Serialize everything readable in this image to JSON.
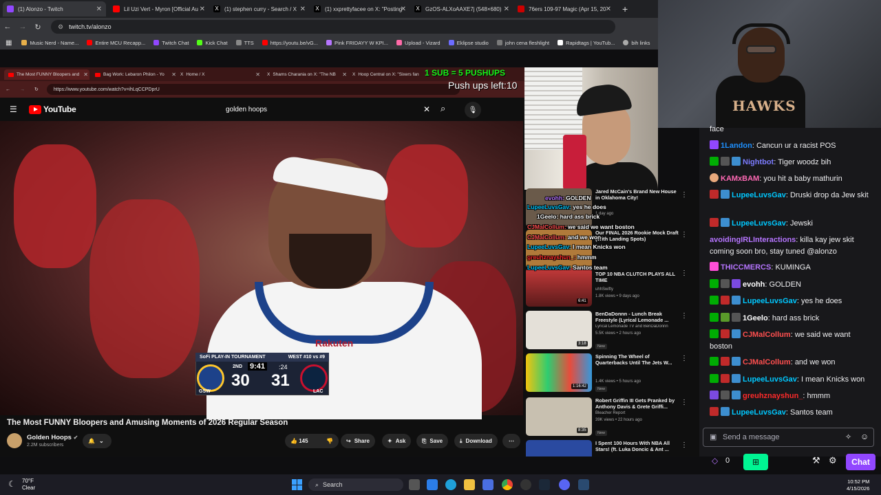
{
  "outer_browser": {
    "tabs": [
      {
        "label": "(1) Alonzo - Twitch",
        "active": true
      },
      {
        "label": "Lil Uzi Vert - Myron [Official Au"
      },
      {
        "label": "(1) stephen curry - Search / X"
      },
      {
        "label": "(1) xxprettyfacee on X: \"Posting"
      },
      {
        "label": "GzOS-ALXoAAXE7j (548×680)"
      },
      {
        "label": "76ers 109-97 Magic (Apr 15, 20"
      }
    ],
    "new_tab": "+",
    "url": "twitch.tv/alonzo",
    "bookmarks": [
      "Music Nerd - Name...",
      "Entire MCU Recapp...",
      "Twitch Chat",
      "Kick Chat",
      "TTS",
      "https://youtu.be/vG...",
      "Pink FRIDAYY W KPI...",
      "Upload - Vizard",
      "Eklipse studio",
      "john cena fleshlight",
      "Rapidtags | YouTub...",
      "bih links"
    ]
  },
  "overlay": {
    "sub_goal": "1 SUB = 5 PUSHUPS",
    "pushups_left": "Push ups left:10"
  },
  "inner_browser": {
    "tabs": [
      {
        "label": "The Most FUNNY Bloopers and",
        "active": true
      },
      {
        "label": "Bag Work: Lebaron Philon - Yo"
      },
      {
        "label": "Home / X"
      },
      {
        "label": "Shams Charania on X: \"The NB"
      },
      {
        "label": "Hoop Central on X: \"Sixers fan"
      }
    ],
    "url": "https://www.youtube.com/watch?v=ihLqCCPDprU"
  },
  "youtube": {
    "logo": "YouTube",
    "search_value": "golden hoops",
    "video_title": "The Most FUNNY Bloopers and Amusing Moments of 2026 Regular Season",
    "channel": "Golden Hoops",
    "subscribers": "2.2M subscribers",
    "likes": "145",
    "share": "Share",
    "ask": "Ask",
    "save": "Save",
    "download": "Download"
  },
  "scorebug": {
    "event": "SoFi PLAY-IN TOURNAMENT",
    "matchup": "WEST #10 vs #9",
    "quarter": "2ND",
    "clock": "9:41",
    "shot_clock": ":24",
    "home_score": "30",
    "away_score": "31",
    "home_team": "GSW",
    "away_team": "LAC"
  },
  "recommendations": [
    {
      "title": "Jared McCain's Brand New House in Oklahoma City!",
      "channel": "",
      "views": "1 day ago",
      "duration": "",
      "new": false
    },
    {
      "title": "Our FINAL 2026 Rookie Mock Draft (With Landing Spots)",
      "channel": "",
      "views": "",
      "duration": "",
      "new": false
    },
    {
      "title": "TOP 10 NBA CLUTCH PLAYS ALL TIME",
      "channel": "uhhSwifty",
      "views": "1.8K views • 9 days ago",
      "duration": "6:41",
      "new": false
    },
    {
      "title": "BenDaDonnn - Lunch Break Freestyle (Lyrical Lemonade ...",
      "channel": "Lyrical Lemonade TV and BenDaDonnn",
      "views": "5.5K views • 2 hours ago",
      "duration": "3:18",
      "new": true
    },
    {
      "title": "Spinning The Wheel of Quarterbacks Until The Jets W...",
      "channel": "",
      "views": "1.4K views • 5 hours ago",
      "duration": "1:16:42",
      "new": true
    },
    {
      "title": "Robert Griffin III Gets Pranked by Anthony Davis & Grete Griffi...",
      "channel": "Bleacher Report",
      "views": "39K views • 22 hours ago",
      "duration": "8:35",
      "new": true
    },
    {
      "title": "I Spent 100 Hours With NBA All Stars! (ft. Luka Doncic & Ant ...",
      "channel": "",
      "views": "",
      "duration": "",
      "new": false
    }
  ],
  "chat_overlay": [
    "GOLDEN",
    "yes he does",
    "hard ass brick",
    "we said we want boston",
    "and we won",
    "I mean Knicks won",
    "hmmm",
    "Santos team"
  ],
  "chat_overlay_names": [
    "evohh:",
    "LupeeLuvsGav:",
    "1Geelo:",
    "CJMalCollum:",
    "CJMalCollum:",
    "LupeeLuvsGav:",
    "greuhznayshun_:",
    "LupeeLuvsGav:"
  ],
  "twitch_chat": {
    "partial": "face",
    "messages": [
      {
        "user": "1Landon",
        "text": "Cancun ur a racist POS",
        "color": "#1e90ff"
      },
      {
        "user": "Nightbot",
        "text": "Tiger woodz bih",
        "color": "#7c7cff"
      },
      {
        "user": "KAMxBAM",
        "text": "you hit a baby mathurin",
        "color": "#ff69b4"
      },
      {
        "user": "LupeeLuvsGav",
        "text": "Druski drop da Jew skit",
        "color": "#00c8ff"
      },
      {
        "user": "LupeeLuvsGav",
        "text": "Jewski",
        "color": "#00c8ff"
      },
      {
        "user": "avoidingIRLInteractions",
        "text": "killa kay jew skit coming soon bro, stay tuned @alonzo",
        "color": "#b675ff"
      },
      {
        "user": "THICCMERCS",
        "text": "KUMINGA",
        "color": "#b675ff"
      },
      {
        "user": "evohh",
        "text": "GOLDEN",
        "color": "#ffffff"
      },
      {
        "user": "LupeeLuvsGav",
        "text": "yes he does",
        "color": "#00c8ff"
      },
      {
        "user": "1Geelo",
        "text": "hard ass brick",
        "color": "#ffffff"
      },
      {
        "user": "CJMalCollum",
        "text": "we said we want boston",
        "color": "#ff4f4f"
      },
      {
        "user": "CJMalCollum",
        "text": "and we won",
        "color": "#ff4f4f"
      },
      {
        "user": "LupeeLuvsGav",
        "text": "I mean Knicks won",
        "color": "#00c8ff"
      },
      {
        "user": "greuhznayshun_",
        "text": "hmmm",
        "color": "#ff2a2a"
      },
      {
        "user": "LupeeLuvsGav",
        "text": "Santos team",
        "color": "#00c8ff"
      }
    ],
    "input_placeholder": "Send a message",
    "points": "0",
    "chat_button": "Chat"
  },
  "taskbar": {
    "temp": "70°F",
    "condition": "Clear",
    "search": "Search",
    "time": "10:52 PM",
    "date": "4/15/2026"
  }
}
